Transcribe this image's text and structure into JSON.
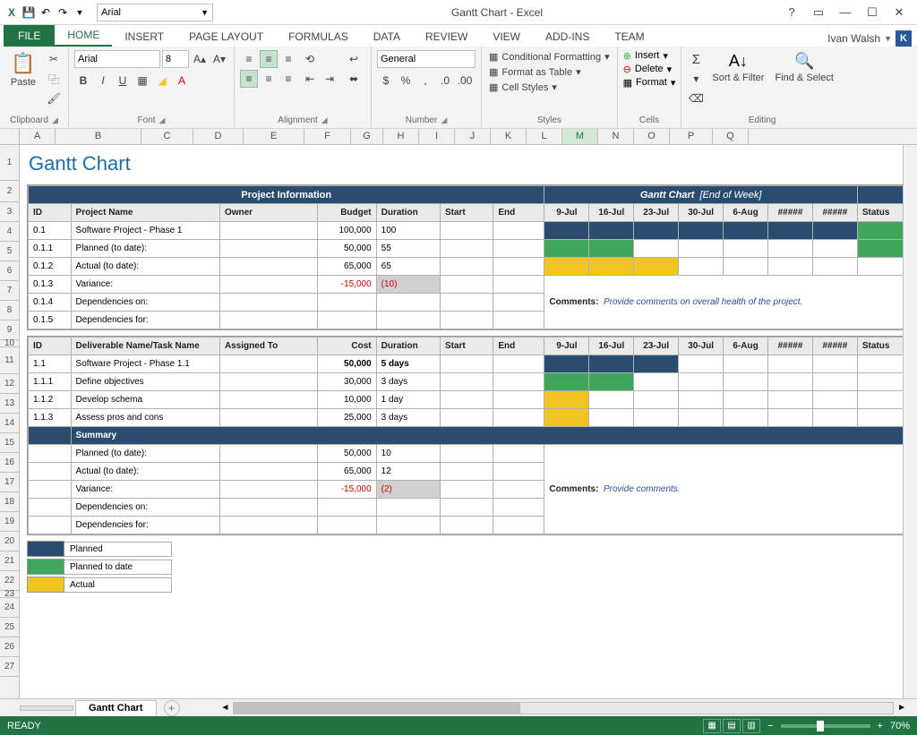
{
  "title": "Gantt Chart - Excel",
  "qat_font": "Arial",
  "user_name": "Ivan Walsh",
  "user_initial": "K",
  "tabs": {
    "file": "FILE",
    "home": "HOME",
    "insert": "INSERT",
    "page": "PAGE LAYOUT",
    "formulas": "FORMULAS",
    "data": "DATA",
    "review": "REVIEW",
    "view": "VIEW",
    "addins": "ADD-INS",
    "team": "TEAM"
  },
  "ribbon": {
    "clipboard": {
      "paste": "Paste",
      "label": "Clipboard"
    },
    "font": {
      "name": "Arial",
      "size": "8",
      "label": "Font"
    },
    "alignment": {
      "label": "Alignment"
    },
    "number": {
      "format": "General",
      "label": "Number"
    },
    "styles": {
      "cf": "Conditional Formatting",
      "ft": "Format as Table",
      "cs": "Cell Styles",
      "label": "Styles"
    },
    "cells": {
      "insert": "Insert",
      "delete": "Delete",
      "format": "Format",
      "label": "Cells"
    },
    "editing": {
      "sort": "Sort & Filter",
      "find": "Find & Select",
      "label": "Editing"
    }
  },
  "columns": [
    "A",
    "B",
    "C",
    "D",
    "E",
    "F",
    "G",
    "H",
    "I",
    "J",
    "K",
    "L",
    "M",
    "N",
    "O",
    "P",
    "Q"
  ],
  "selected_col": "M",
  "row_count": 27,
  "sheet": {
    "title": "Gantt Chart",
    "proj_info_hdr": "Project Information",
    "gantt_hdr": "Gantt Chart",
    "gantt_hdr_sub": "[End of Week]",
    "hdrs": {
      "id": "ID",
      "pname": "Project Name",
      "owner": "Owner",
      "budget": "Budget",
      "dur": "Duration",
      "start": "Start",
      "end": "End",
      "status": "Status"
    },
    "dates": [
      "9-Jul",
      "16-Jul",
      "23-Jul",
      "30-Jul",
      "6-Aug",
      "#####",
      "#####"
    ],
    "proj_rows": [
      {
        "id": "0.1",
        "name": "Software Project - Phase 1",
        "budget": "100,000",
        "dur": "100",
        "g": [
          "b",
          "b",
          "b",
          "b",
          "b",
          "b",
          "b"
        ],
        "st": "g"
      },
      {
        "id": "0.1.1",
        "name": "Planned (to date):",
        "budget": "50,000",
        "dur": "55",
        "g": [
          "g",
          "g",
          "",
          "",
          "",
          "",
          ""
        ],
        "st": "g"
      },
      {
        "id": "0.1.2",
        "name": "Actual (to date):",
        "budget": "65,000",
        "dur": "65",
        "g": [
          "y",
          "y",
          "y",
          "",
          "",
          "",
          ""
        ],
        "st": ""
      },
      {
        "id": "0.1.3",
        "name": "Variance:",
        "budget": "-15,000",
        "dur": "(10)",
        "neg": true,
        "shade": true
      },
      {
        "id": "0.1.4",
        "name": "Dependencies on:"
      },
      {
        "id": "0.1.5",
        "name": "Dependencies for:"
      }
    ],
    "comments1_lbl": "Comments:",
    "comments1_txt": "Provide comments on overall health of the project.",
    "hdrs2": {
      "id": "ID",
      "dname": "Deliverable Name/Task Name",
      "assigned": "Assigned To",
      "cost": "Cost",
      "dur": "Duration",
      "start": "Start",
      "end": "End",
      "status": "Status"
    },
    "task_rows": [
      {
        "id": "1.1",
        "name": "Software Project - Phase 1.1",
        "cost": "50,000",
        "dur": "5 days",
        "bold": true,
        "g": [
          "b",
          "b",
          "b",
          "",
          "",
          "",
          ""
        ]
      },
      {
        "id": "1.1.1",
        "name": "Define objectives",
        "cost": "30,000",
        "dur": "3 days",
        "g": [
          "g",
          "g",
          "",
          "",
          "",
          "",
          ""
        ]
      },
      {
        "id": "1.1.2",
        "name": "Develop schema",
        "cost": "10,000",
        "dur": "1 day",
        "g": [
          "y",
          "",
          "",
          "",
          "",
          "",
          ""
        ]
      },
      {
        "id": "1.1.3",
        "name": "Assess pros and cons",
        "cost": "25,000",
        "dur": "3 days",
        "g": [
          "y",
          "",
          "",
          "",
          "",
          "",
          ""
        ]
      }
    ],
    "summary_hdr": "Summary",
    "sum_rows": [
      {
        "name": "Planned (to date):",
        "cost": "50,000",
        "dur": "10"
      },
      {
        "name": "Actual (to date):",
        "cost": "65,000",
        "dur": "12"
      },
      {
        "name": "Variance:",
        "cost": "-15,000",
        "dur": "(2)",
        "neg": true,
        "shade": true
      },
      {
        "name": "Dependencies on:"
      },
      {
        "name": "Dependencies for:"
      }
    ],
    "comments2_lbl": "Comments:",
    "comments2_txt": "Provide comments.",
    "legend": [
      {
        "color": "#2a4d6f",
        "label": "Planned"
      },
      {
        "color": "#3fa65c",
        "label": "Planned to date"
      },
      {
        "color": "#f2c41f",
        "label": "Actual"
      }
    ]
  },
  "sheet_tabs": {
    "blank": "",
    "active": "Gantt Chart"
  },
  "status": {
    "ready": "READY",
    "zoom": "70%"
  }
}
